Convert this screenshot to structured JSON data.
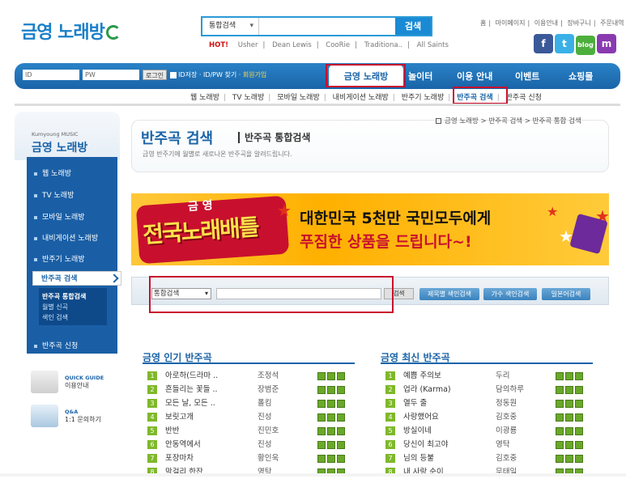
{
  "brand": {
    "logo_text": "금영 노래방"
  },
  "top_search": {
    "category": "통합검색",
    "button": "검색"
  },
  "hot": {
    "label": "HOT!",
    "keywords": [
      "Usher",
      "Dean Lewis",
      "CooRie",
      "Traditiona..",
      "All Saints"
    ]
  },
  "util_links": [
    "홈",
    "마이페이지",
    "이용안내",
    "장바구니",
    "주문내역"
  ],
  "sns": [
    "f",
    "t",
    "blog",
    "m"
  ],
  "login": {
    "id_placeholder": "ID",
    "pw_placeholder": "PW",
    "login_button": "로그인",
    "options": "ID저장 · ID/PW 찾기 ·",
    "join": "회원가입"
  },
  "nav": {
    "active": "금영 노래방",
    "items": [
      "놀이터",
      "이용 안내",
      "이벤트",
      "쇼핑몰"
    ]
  },
  "subnav": [
    "웹 노래방",
    "TV 노래방",
    "모바일 노래방",
    "내비게이션 노래방",
    "반주기 노래방",
    "반주곡 검색",
    "반주곡 신청"
  ],
  "subnav_active_index": 5,
  "sidebar": {
    "brand_en": "Kumyoung MUSIC",
    "title": "금영 노래방",
    "items": [
      "웹 노래방",
      "TV 노래방",
      "모바일 노래방",
      "내비게이션 노래방",
      "반주기 노래방"
    ],
    "active": "반주곡 검색",
    "sub_items": [
      "반주곡 통합검색",
      "월별 신곡",
      "색인 검색"
    ],
    "last": "반주곡 신청",
    "guide1": {
      "t1": "QUICK GUIDE",
      "t2": "이용안내"
    },
    "guide2": {
      "t1": "Q&A",
      "t2": "1:1 문의하기"
    }
  },
  "breadcrumb": "금영 노래방 > 반주곡 검색 > 반주곡 통합 검색",
  "page": {
    "title": "반주곡 검색",
    "subtitle": "반주곡 통합검색",
    "desc": "금영 반주기에 월별로 새로나온 반주곡을 알려드립니다."
  },
  "banner": {
    "left_small": "금 영",
    "left_big": "전국노래배틀",
    "line1": "대한민국 5천만 국민모두에게",
    "line2": "푸짐한 상품을 드립니다~!"
  },
  "search_panel": {
    "category": "통합검색",
    "button": "검색",
    "btn1": "제목별 색인검색",
    "btn2": "가수 색인검색",
    "btn3": "일본어검색"
  },
  "popular": {
    "title": "금영 인기 반주곡",
    "rows": [
      {
        "n": "1",
        "song": "아로하(드라마 ..",
        "artist": "조정석"
      },
      {
        "n": "2",
        "song": "흔들리는 꽃들 ..",
        "artist": "장범준"
      },
      {
        "n": "3",
        "song": "모든 날, 모든 ..",
        "artist": "폴킴"
      },
      {
        "n": "4",
        "song": "보릿고개",
        "artist": "진성"
      },
      {
        "n": "5",
        "song": "반반",
        "artist": "진민호"
      },
      {
        "n": "6",
        "song": "안동역에서",
        "artist": "진성"
      },
      {
        "n": "7",
        "song": "포장마차",
        "artist": "황인욱"
      },
      {
        "n": "8",
        "song": "막걸리 한잔",
        "artist": "영탁"
      }
    ]
  },
  "latest": {
    "title": "금영 최신 반주곡",
    "rows": [
      {
        "n": "1",
        "song": "예쁨 주의보",
        "artist": "두리"
      },
      {
        "n": "2",
        "song": "업라 (Karma)",
        "artist": "담의하루"
      },
      {
        "n": "3",
        "song": "열두 줄",
        "artist": "정동원"
      },
      {
        "n": "4",
        "song": "사랑했어요",
        "artist": "김호중"
      },
      {
        "n": "5",
        "song": "방실이네",
        "artist": "이광룡"
      },
      {
        "n": "6",
        "song": "당신이 최고야",
        "artist": "영탁"
      },
      {
        "n": "7",
        "song": "님의 등불",
        "artist": "김호중"
      },
      {
        "n": "8",
        "song": "내 사랑 순이",
        "artist": "무태일"
      }
    ]
  }
}
